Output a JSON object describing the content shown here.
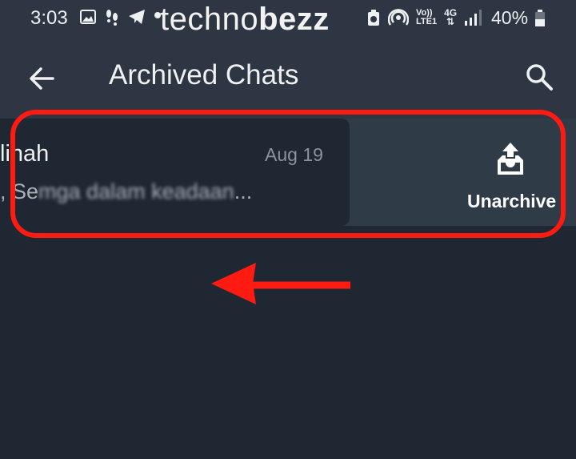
{
  "status_bar": {
    "time": "3:03",
    "battery": "40%",
    "icons_left": [
      "image-icon",
      "footsteps-icon",
      "telegram-icon",
      "dot-icon"
    ],
    "icons_right": [
      "recycle-icon",
      "hotspot-icon",
      "volte-icon",
      "4g-data-icon",
      "signal-icon"
    ],
    "volte_label_top": "Vo))",
    "volte_label_bottom": "LTE1",
    "network_label": "4G"
  },
  "watermark": {
    "light": "techno",
    "bold": "bezz"
  },
  "app_bar": {
    "title": "Archived Chats",
    "back_icon": "back-arrow-icon",
    "search_icon": "search-icon"
  },
  "chat": {
    "name": "linah",
    "date": "Aug 19",
    "preview_lead": ", Se",
    "preview_blurred": "mga dalam keadaan",
    "preview_tail": "..."
  },
  "swipe_action": {
    "label": "Unarchive",
    "icon": "unarchive-icon"
  },
  "annotation": {
    "frame_color": "#ff1a12",
    "arrow": "left-arrow-icon"
  },
  "colors": {
    "background": "#1f2733",
    "app_bar": "#2d3642",
    "action_panel": "#2f3b47",
    "text_secondary": "#8b939b"
  }
}
